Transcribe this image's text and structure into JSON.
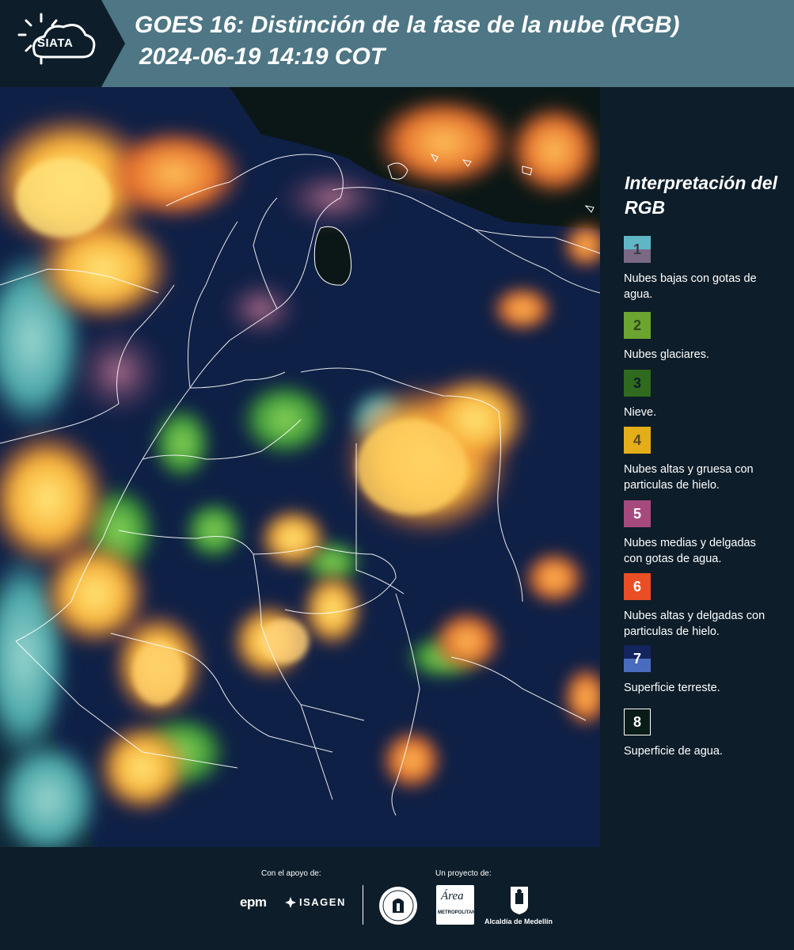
{
  "header": {
    "logo_text": "SIATA",
    "title": "GOES 16: Distinción de la fase de la nube (RGB)",
    "subtitle": "2024-06-19 14:19 COT"
  },
  "legend": {
    "title": "Interpretación del RGB",
    "items": [
      {
        "num": "1",
        "label": "Nubes bajas con gotas de agua.",
        "color_top": "#5fb7c6",
        "color_bottom": "#7a6985",
        "text_color": "#3a3a4a"
      },
      {
        "num": "2",
        "label": "Nubes glaciares.",
        "color_top": "#6ba42f",
        "color_bottom": "#6ba42f",
        "text_color": "#2f4a1a"
      },
      {
        "num": "3",
        "label": "Nieve.",
        "color_top": "#2f6a1e",
        "color_bottom": "#2f6a1e",
        "text_color": "#0d1d29"
      },
      {
        "num": "4",
        "label": "Nubes altas y gruesa con particulas de hielo.",
        "color_top": "#e3ae1a",
        "color_bottom": "#e3ae1a",
        "text_color": "#5a4a1a"
      },
      {
        "num": "5",
        "label": "Nubes medias y delgadas con gotas de agua.",
        "color_top": "#a64a7e",
        "color_bottom": "#a64a7e",
        "text_color": "#ffffff"
      },
      {
        "num": "6",
        "label": "Nubes altas y delgadas con particulas de hielo.",
        "color_top": "#e94e25",
        "color_bottom": "#e94e25",
        "text_color": "#ffffff"
      },
      {
        "num": "7",
        "label": "Superficie terreste.",
        "color_top": "#14245c",
        "color_bottom": "#4a6cbf",
        "text_color": "#ffffff"
      },
      {
        "num": "8",
        "label": "Superficie de agua.",
        "color_top": "#0a1c18",
        "color_bottom": "#0a1c18",
        "text_color": "#ffffff"
      }
    ]
  },
  "footer": {
    "support_label": "Con el apoyo de:",
    "project_label": "Un proyecto de:",
    "epm": "epm",
    "isagen": "ISAGEN",
    "area_logo": "Área",
    "area_sub": "METROPOLITANA",
    "alcaldia": "Alcaldía de Medellín"
  }
}
